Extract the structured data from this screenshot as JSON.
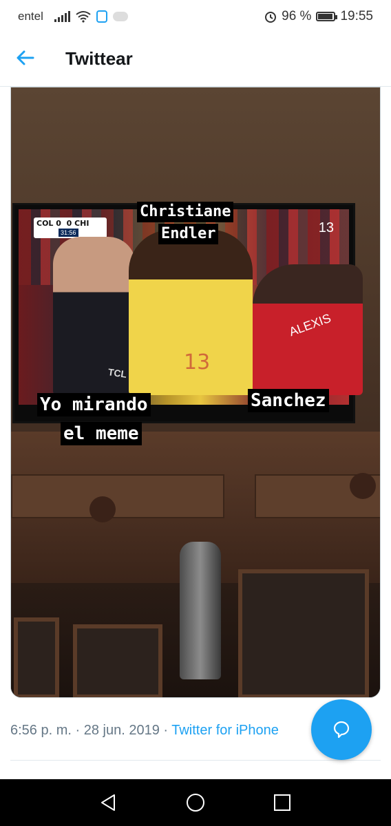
{
  "status_bar": {
    "carrier": "entel",
    "battery": "96 %",
    "battery_level": 0.96,
    "time": "19:55",
    "icons": [
      "signal-icon",
      "wifi-icon",
      "shield-icon",
      "cloud-icon",
      "alarm-icon",
      "battery-icon"
    ]
  },
  "header": {
    "back_icon": "arrow-left-icon",
    "title": "Twittear"
  },
  "media": {
    "captions": {
      "top_line1": "Christiane",
      "top_line2": "Endler",
      "right": "Sanchez",
      "left_line1": "Yo mirando",
      "left_line2": "el meme"
    },
    "tv": {
      "score": "COL 0",
      "score_away": "0 CHI",
      "clock": "31:56",
      "channel": "13",
      "brand": "TCL",
      "jersey_number": "13",
      "jersey_name": "ALEXIS"
    }
  },
  "tweet_meta": {
    "time": "6:56 p. m.",
    "separator": " · ",
    "date": "28 jun. 2019",
    "source": "Twitter for iPhone"
  },
  "fab": {
    "icon": "reply-bubble-icon"
  },
  "nav": {
    "icons": [
      "back-triangle-icon",
      "home-circle-icon",
      "recents-square-icon"
    ]
  },
  "colors": {
    "accent": "#1da1f2",
    "meta_text": "#657786"
  }
}
